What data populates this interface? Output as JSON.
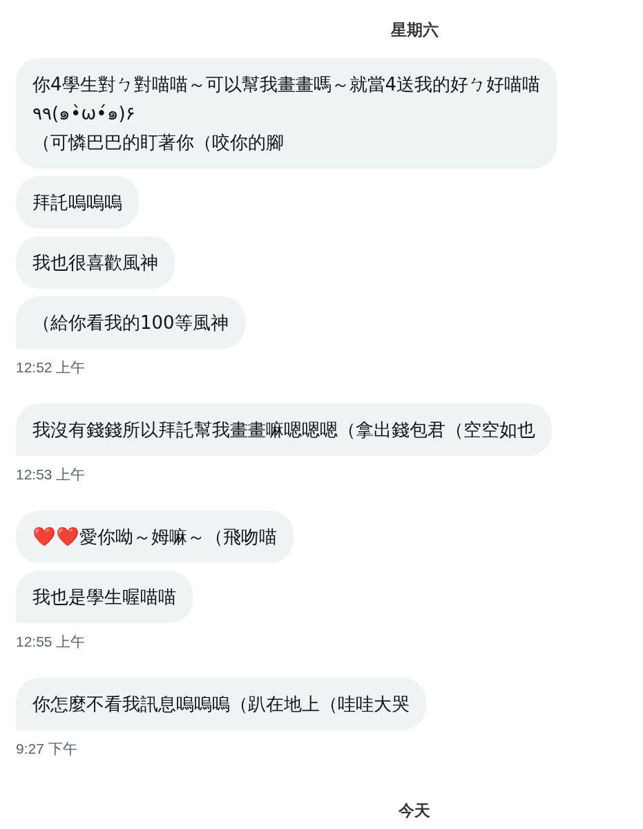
{
  "timeline": [
    {
      "kind": "day",
      "label": "星期六"
    },
    {
      "kind": "group",
      "messages": [
        {
          "text": "你4學生對ㄅ對喵喵～可以幫我畫畫嗎～就當4送我的好ㄅ好喵喵\n٩٩(๑•̀ω•́๑)۶\n（可憐巴巴的盯著你（咬你的腳"
        },
        {
          "text": "拜託嗚嗚嗚"
        },
        {
          "text": "我也很喜歡風神"
        },
        {
          "text": "（給你看我的100等風神"
        }
      ],
      "time": "12:52 上午"
    },
    {
      "kind": "group",
      "messages": [
        {
          "text": "我沒有錢錢所以拜託幫我畫畫嘛嗯嗯嗯（拿出錢包君（空空如也"
        }
      ],
      "time": "12:53 上午"
    },
    {
      "kind": "group",
      "messages": [
        {
          "parts": [
            {
              "kind": "emoji",
              "text": "❤️"
            },
            {
              "kind": "emoji",
              "text": "❤️"
            },
            {
              "kind": "text",
              "text": "愛你呦～姆嘛～（飛吻喵"
            }
          ]
        },
        {
          "text": "我也是學生喔喵喵"
        }
      ],
      "time": "12:55 上午"
    },
    {
      "kind": "group",
      "messages": [
        {
          "text": "你怎麼不看我訊息嗚嗚嗚（趴在地上（哇哇大哭"
        }
      ],
      "time": "9:27 下午"
    },
    {
      "kind": "day",
      "label": "今天"
    }
  ]
}
